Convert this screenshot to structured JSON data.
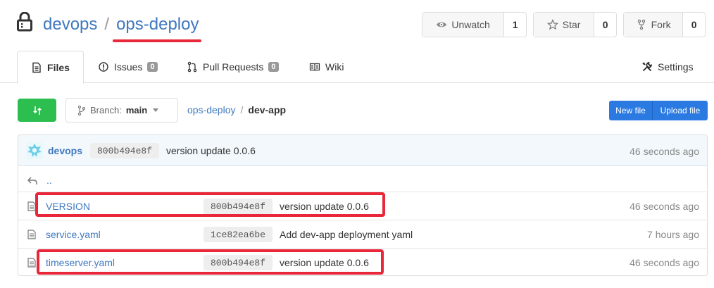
{
  "header": {
    "owner": "devops",
    "separator": "/",
    "repo": "ops-deploy",
    "actions": {
      "watch_label": "Unwatch",
      "watch_count": "1",
      "star_label": "Star",
      "star_count": "0",
      "fork_label": "Fork",
      "fork_count": "0"
    }
  },
  "tabs": {
    "files": "Files",
    "issues": "Issues",
    "issues_count": "0",
    "pulls": "Pull Requests",
    "pulls_count": "0",
    "wiki": "Wiki",
    "settings": "Settings"
  },
  "toolbar": {
    "branch_prefix": "Branch:",
    "branch_name": "main",
    "path_root": "ops-deploy",
    "path_sep": "/",
    "path_current": "dev-app",
    "new_file": "New file",
    "upload_file": "Upload file"
  },
  "latest_commit": {
    "author": "devops",
    "sha": "800b494e8f",
    "message": "version update 0.0.6",
    "age": "46 seconds ago"
  },
  "parent_dir": "..",
  "files": [
    {
      "name": "VERSION",
      "sha": "800b494e8f",
      "message": "version update 0.0.6",
      "age": "46 seconds ago"
    },
    {
      "name": "service.yaml",
      "sha": "1ce82ea6be",
      "message": "Add dev-app deployment yaml",
      "age": "7 hours ago"
    },
    {
      "name": "timeserver.yaml",
      "sha": "800b494e8f",
      "message": "version update 0.0.6",
      "age": "46 seconds ago"
    }
  ],
  "colors": {
    "link": "#4078c0",
    "green_button": "#2cbe4e",
    "blue_button": "#2a7ae2",
    "highlight": "#e8283a"
  },
  "icons": [
    "repo-icon",
    "eye-icon",
    "star-icon",
    "fork-icon",
    "file-icon",
    "issue-icon",
    "pull-request-icon",
    "wiki-icon",
    "settings-icon",
    "compare-icon",
    "branch-icon",
    "avatar",
    "level-up-icon"
  ]
}
